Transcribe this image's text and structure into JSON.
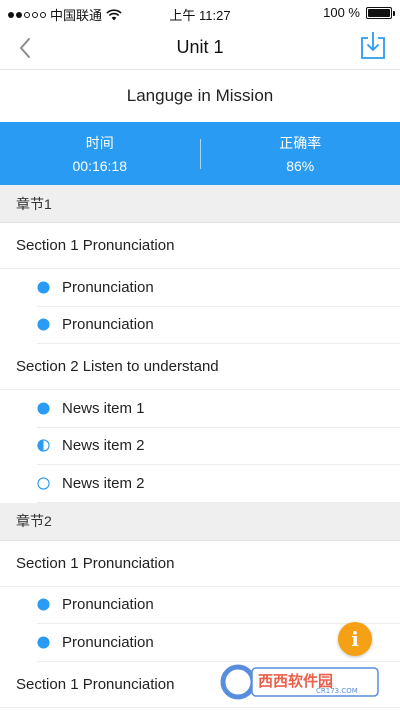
{
  "status_bar": {
    "carrier": "中国联通",
    "time": "上午 11:27",
    "battery": "100 %"
  },
  "nav": {
    "title": "Unit 1",
    "back_icon": "chevron-left-icon",
    "download_icon": "download-icon"
  },
  "mission": {
    "title": "Languge in Mission"
  },
  "stats": {
    "time_label": "时间",
    "time_value": "00:16:18",
    "accuracy_label": "正确率",
    "accuracy_value": "86%"
  },
  "chapters": [
    {
      "title": "章节1",
      "sections": [
        {
          "title": "Section 1 Pronunciation",
          "items": [
            {
              "label": "Pronunciation",
              "progress": 1.0
            },
            {
              "label": "Pronunciation",
              "progress": 1.0
            }
          ]
        },
        {
          "title": "Section 2 Listen to understand",
          "items": [
            {
              "label": "News item 1",
              "progress": 1.0
            },
            {
              "label": "News item 2",
              "progress": 0.5
            },
            {
              "label": "News item 2",
              "progress": 0.0
            }
          ]
        }
      ]
    },
    {
      "title": "章节2",
      "sections": [
        {
          "title": "Section 1 Pronunciation",
          "items": [
            {
              "label": "Pronunciation",
              "progress": 1.0
            },
            {
              "label": "Pronunciation",
              "progress": 1.0
            }
          ]
        },
        {
          "title": "Section 1 Pronunciation",
          "items": []
        }
      ]
    }
  ],
  "info_button": {
    "label": "i"
  },
  "watermark": {
    "text": "西西软件园",
    "subtext": "CR173.COM"
  },
  "colors": {
    "accent": "#2a9bf2",
    "fab": "#f5a015"
  }
}
